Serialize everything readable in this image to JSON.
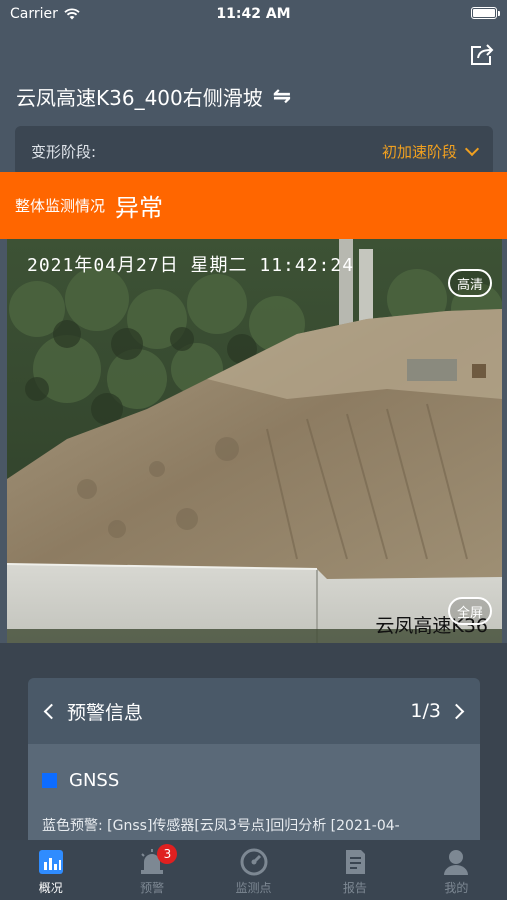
{
  "status_bar": {
    "carrier": "Carrier",
    "time": "11:42 AM"
  },
  "header": {
    "title": "云凤高速K36_400右侧滑坡",
    "swap_icon": "⇋"
  },
  "stage": {
    "label": "变形阶段:",
    "value": "初加速阶段"
  },
  "alert": {
    "label": "整体监测情况",
    "status": "异常"
  },
  "video": {
    "timestamp": "2021年04月27日  星期二  11:42:24",
    "hd_label": "高清",
    "fullscreen_label": "全屏",
    "caption": "云凤高速K36"
  },
  "warning": {
    "title": "预警信息",
    "page": "1/3",
    "item_name": "GNSS",
    "item_text": "蓝色预警: [Gnss]传感器[云凤3号点]回归分析 [2021-04-"
  },
  "tabs": [
    {
      "label": "概况",
      "icon": "chart-icon",
      "active": true
    },
    {
      "label": "预警",
      "icon": "alarm-icon",
      "badge": "3"
    },
    {
      "label": "监测点",
      "icon": "gauge-icon"
    },
    {
      "label": "报告",
      "icon": "report-icon"
    },
    {
      "label": "我的",
      "icon": "user-icon"
    }
  ],
  "colors": {
    "accent_orange": "#ff6600",
    "stage_value": "#f0a020",
    "gnss_blue": "#0d6cff",
    "badge_red": "#e02020"
  }
}
